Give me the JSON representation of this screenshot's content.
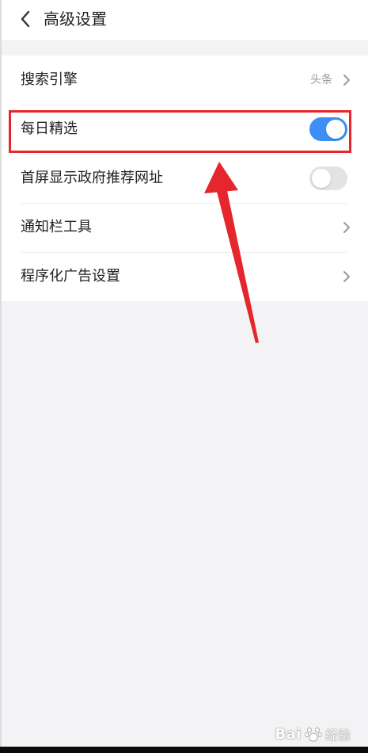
{
  "header": {
    "title": "高级设置",
    "back_icon": "chevron-left-icon"
  },
  "settings": [
    {
      "label": "搜索引擎",
      "value": "头条",
      "control": "chevron"
    },
    {
      "label": "每日精选",
      "control": "toggle",
      "on": true
    },
    {
      "label": "首屏显示政府推荐网址",
      "control": "toggle",
      "on": false
    },
    {
      "label": "通知栏工具",
      "control": "chevron"
    },
    {
      "label": "程序化广告设置",
      "control": "chevron"
    }
  ],
  "annotation": {
    "highlight_color": "#e5262c",
    "arrow_color": "#e5262c"
  },
  "watermark": {
    "brand": "Bai",
    "suffix": "经验",
    "icon": "baidu-paw-icon"
  },
  "colors": {
    "toggle_on": "#3e8ef7",
    "toggle_off": "#e3e3e3",
    "background": "#f3f3f5"
  }
}
